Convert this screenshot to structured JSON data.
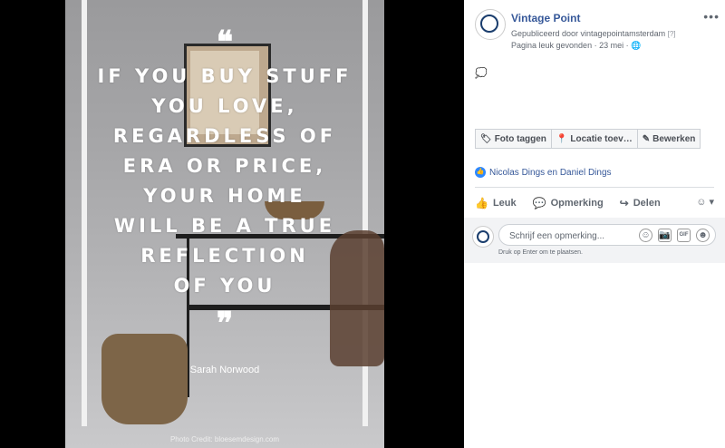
{
  "photo": {
    "quote_open": "❝",
    "quote_text": "IF YOU BUY STUFF\nYOU LOVE,\nREGARDLESS OF\nERA OR PRICE,\nYOUR HOME\nWILL BE A TRUE\nREFLECTION\nOF YOU",
    "quote_close": "❞",
    "author": "Sarah Norwood",
    "credit": "Photo Credit: bloesemdesign.com"
  },
  "post": {
    "page_name": "Vintage Point",
    "published_by": "Gepubliceerd door vintagepointamsterdam",
    "help_mark": "[?]",
    "meta": "Pagina leuk gevonden · 23 mei ·",
    "globe_icon": "🌐",
    "more_label": "•••",
    "bubble_icon": "💭"
  },
  "tag_buttons": [
    {
      "icon": "tag-icon",
      "glyph": "🏷",
      "label": "Foto taggen"
    },
    {
      "icon": "location-pin-icon",
      "glyph": "📍",
      "label": "Locatie toev…"
    },
    {
      "icon": "pencil-icon",
      "glyph": "✎",
      "label": "Bewerken"
    }
  ],
  "likes": {
    "glyph": "👍",
    "text": "Nicolas Dings en Daniel Dings"
  },
  "actions": {
    "like": {
      "glyph": "👍",
      "label": "Leuk"
    },
    "comment": {
      "glyph": "💬",
      "label": "Opmerking"
    },
    "share": {
      "glyph": "↪",
      "label": "Delen"
    },
    "reaction_picker": "☺ ▾"
  },
  "comment": {
    "placeholder": "Schrijf een opmerking...",
    "emoji_glyph": "☺",
    "camera_glyph": "📷",
    "gif_label": "GIF",
    "sticker_glyph": "☻",
    "hint": "Druk op Enter om te plaatsen."
  },
  "colors": {
    "link_blue": "#365899",
    "like_blue": "#2d88ff",
    "muted_text": "#606770"
  }
}
